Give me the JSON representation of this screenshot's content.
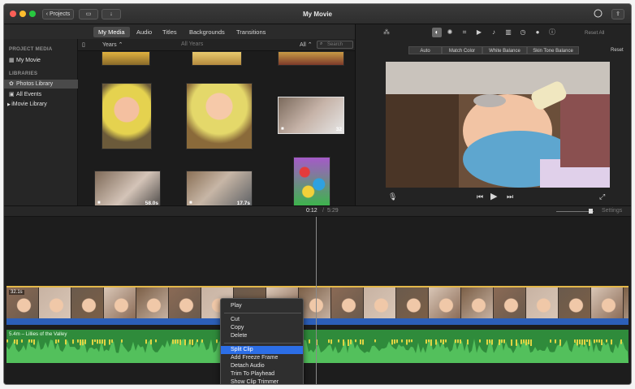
{
  "window": {
    "title": "My Movie",
    "projects_button": "Projects",
    "reset_all": "Reset All",
    "reset": "Reset"
  },
  "media_tabs": [
    "My Media",
    "Audio",
    "Titles",
    "Backgrounds",
    "Transitions"
  ],
  "sidebar": {
    "project_media_header": "PROJECT MEDIA",
    "project_item": "My Movie",
    "libraries_header": "LIBRARIES",
    "items": [
      "Photos Library",
      "All Events",
      "iMovie Library"
    ]
  },
  "browser": {
    "years_filter": "Years",
    "all_years": "All Years",
    "all_filter": "All",
    "search_placeholder": "Search",
    "clips": [
      {
        "duration": "32"
      },
      {
        "duration": "58.0s"
      },
      {
        "duration": "17.7s"
      }
    ]
  },
  "viewer": {
    "color_tabs": [
      "Auto",
      "Match Color",
      "White Balance",
      "Skin Tone Balance"
    ]
  },
  "timeline": {
    "current_time": "0:12",
    "separator": "/",
    "total_time": "5:29",
    "settings": "Settings",
    "clip_badge": "32.1s",
    "audio_label": "5.4m – Lillies of the Valley"
  },
  "context_menu": {
    "items": [
      "Play",
      "Cut",
      "Copy",
      "Delete",
      "Split Clip",
      "Add Freeze Frame",
      "Detach Audio",
      "Trim To Playhead",
      "Show Clip Trimmer"
    ],
    "highlighted": "Split Clip"
  },
  "colors": {
    "accent": "#2c6ee6",
    "audio_track": "#2f8b3b",
    "clip_border": "#e3b84a"
  }
}
